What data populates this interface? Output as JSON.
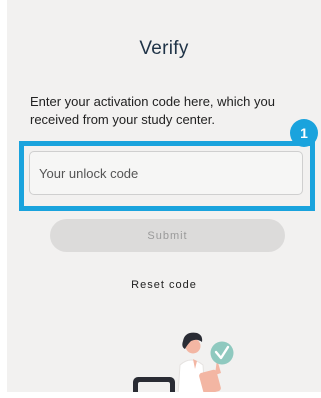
{
  "screen": {
    "title": "Verify",
    "instructions": "Enter your activation code here, which you received from your study center."
  },
  "code_field": {
    "value": "",
    "placeholder": "Your unlock code"
  },
  "callout": {
    "number": "1",
    "color": "#1aa3dd"
  },
  "actions": {
    "submit_label": "Submit",
    "reset_label": "Reset code"
  },
  "illustration": {
    "icons": [
      "person-figure",
      "check-badge-icon",
      "phone-device"
    ],
    "accent_color": "#8fc9bf"
  }
}
